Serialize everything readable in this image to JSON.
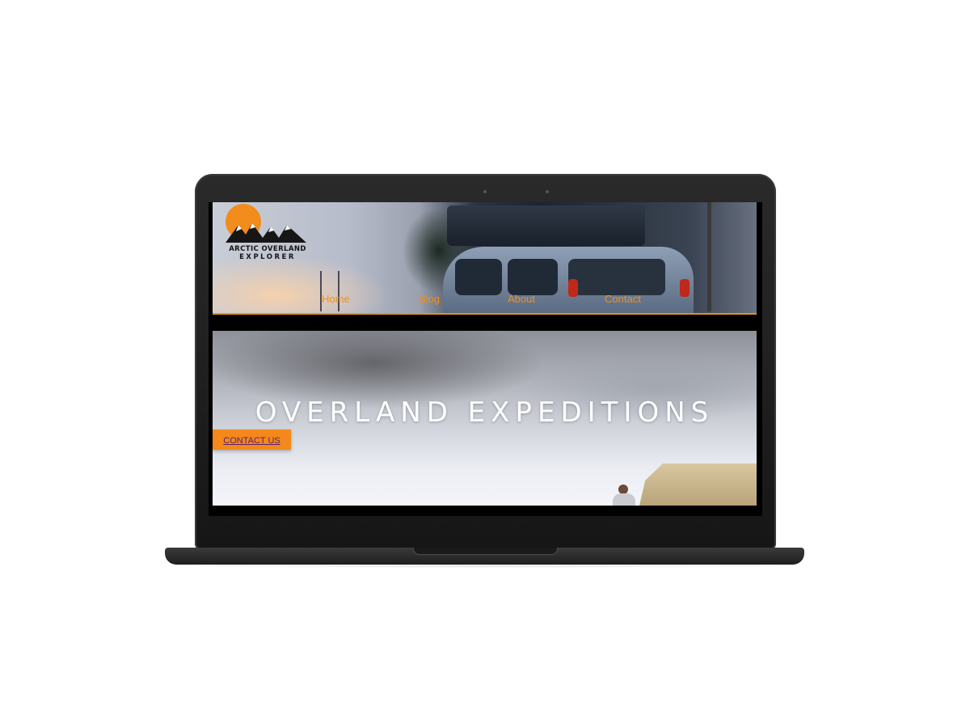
{
  "site": {
    "logo": {
      "line1": "ARCTIC OVERLAND",
      "line2": "EXPLORER"
    },
    "nav": [
      {
        "label": "Home"
      },
      {
        "label": "Blog"
      },
      {
        "label": "About"
      },
      {
        "label": "Contact"
      }
    ]
  },
  "hero": {
    "title": "OVERLAND EXPEDITIONS",
    "cta_label": "CONTACT US"
  },
  "colors": {
    "accent": "#f28c1c",
    "nav_text": "#f2901e",
    "cta_bg": "#f5881a",
    "cta_text": "#5a1f6e",
    "laptop_frame": "#1e1e1e"
  },
  "icons": [
    "logo-sun-mountain-icon",
    "camera-icon"
  ]
}
